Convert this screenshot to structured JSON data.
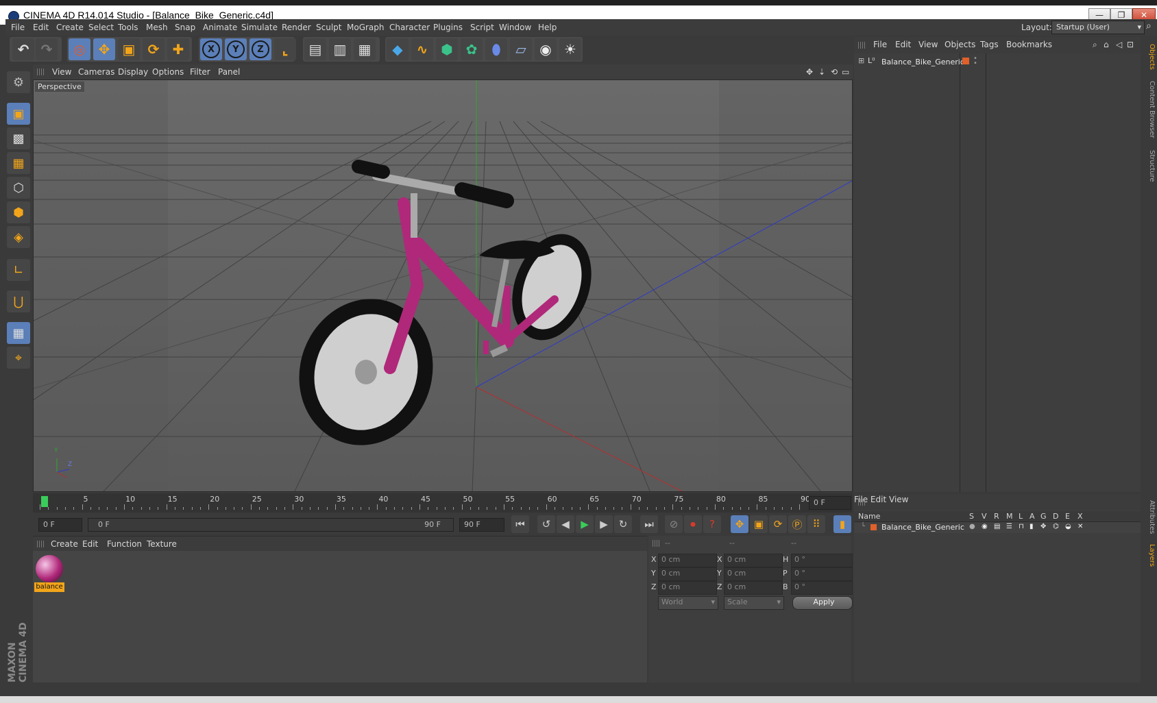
{
  "window": {
    "title": "CINEMA 4D R14.014 Studio - [Balance_Bike_Generic.c4d]",
    "minimize": "—",
    "maximize": "❐",
    "close": "✕"
  },
  "menubar": {
    "items": [
      "File",
      "Edit",
      "Create",
      "Select",
      "Tools",
      "Mesh",
      "Snap",
      "Animate",
      "Simulate",
      "Render",
      "Sculpt",
      "MoGraph",
      "Character",
      "Plugins",
      "Script",
      "Window",
      "Help"
    ],
    "layout_label": "Layout:",
    "layout_value": "Startup (User)"
  },
  "toolbar": {
    "axis_x": "X",
    "axis_y": "Y",
    "axis_z": "Z"
  },
  "viewport": {
    "menu": [
      "View",
      "Cameras",
      "Display",
      "Options",
      "Filter",
      "Panel"
    ],
    "label": "Perspective",
    "axis_y": "Y",
    "axis_z": "Z"
  },
  "timeline": {
    "ticks": [
      "0",
      "5",
      "10",
      "15",
      "20",
      "25",
      "30",
      "35",
      "40",
      "45",
      "50",
      "55",
      "60",
      "65",
      "70",
      "75",
      "80",
      "85",
      "90"
    ],
    "current_frame": "0 F",
    "start_field": "0 F",
    "range_start": "0 F",
    "range_end": "90 F",
    "end_field": "90 F"
  },
  "material_manager": {
    "menu": [
      "Create",
      "Edit",
      "Function",
      "Texture"
    ],
    "material_name": "balance",
    "colors": {
      "material": "#b0287a",
      "highlight": "#f2a51a"
    }
  },
  "coordinates": {
    "headers": [
      "--",
      "--",
      "--"
    ],
    "rows": [
      {
        "l1": "X",
        "v1": "0 cm",
        "l2": "X",
        "v2": "0 cm",
        "l3": "H",
        "v3": "0 °"
      },
      {
        "l1": "Y",
        "v1": "0 cm",
        "l2": "Y",
        "v2": "0 cm",
        "l3": "P",
        "v3": "0 °"
      },
      {
        "l1": "Z",
        "v1": "0 cm",
        "l2": "Z",
        "v2": "0 cm",
        "l3": "B",
        "v3": "0 °"
      }
    ],
    "mode1": "World",
    "mode2": "Scale",
    "apply": "Apply"
  },
  "object_manager": {
    "menu": [
      "File",
      "Edit",
      "View",
      "Objects",
      "Tags",
      "Bookmarks"
    ],
    "object_name": "Balance_Bike_Generic"
  },
  "layer_manager": {
    "menu": [
      "File",
      "Edit",
      "View"
    ],
    "columns": [
      "Name",
      "S",
      "V",
      "R",
      "M",
      "L",
      "A",
      "G",
      "D",
      "E",
      "X"
    ],
    "row_name": "Balance_Bike_Generic"
  },
  "side_tabs": [
    "Objects",
    "Content Browser",
    "Structure",
    "Attributes",
    "Layers"
  ],
  "branding": "MAXON CINEMA 4D"
}
